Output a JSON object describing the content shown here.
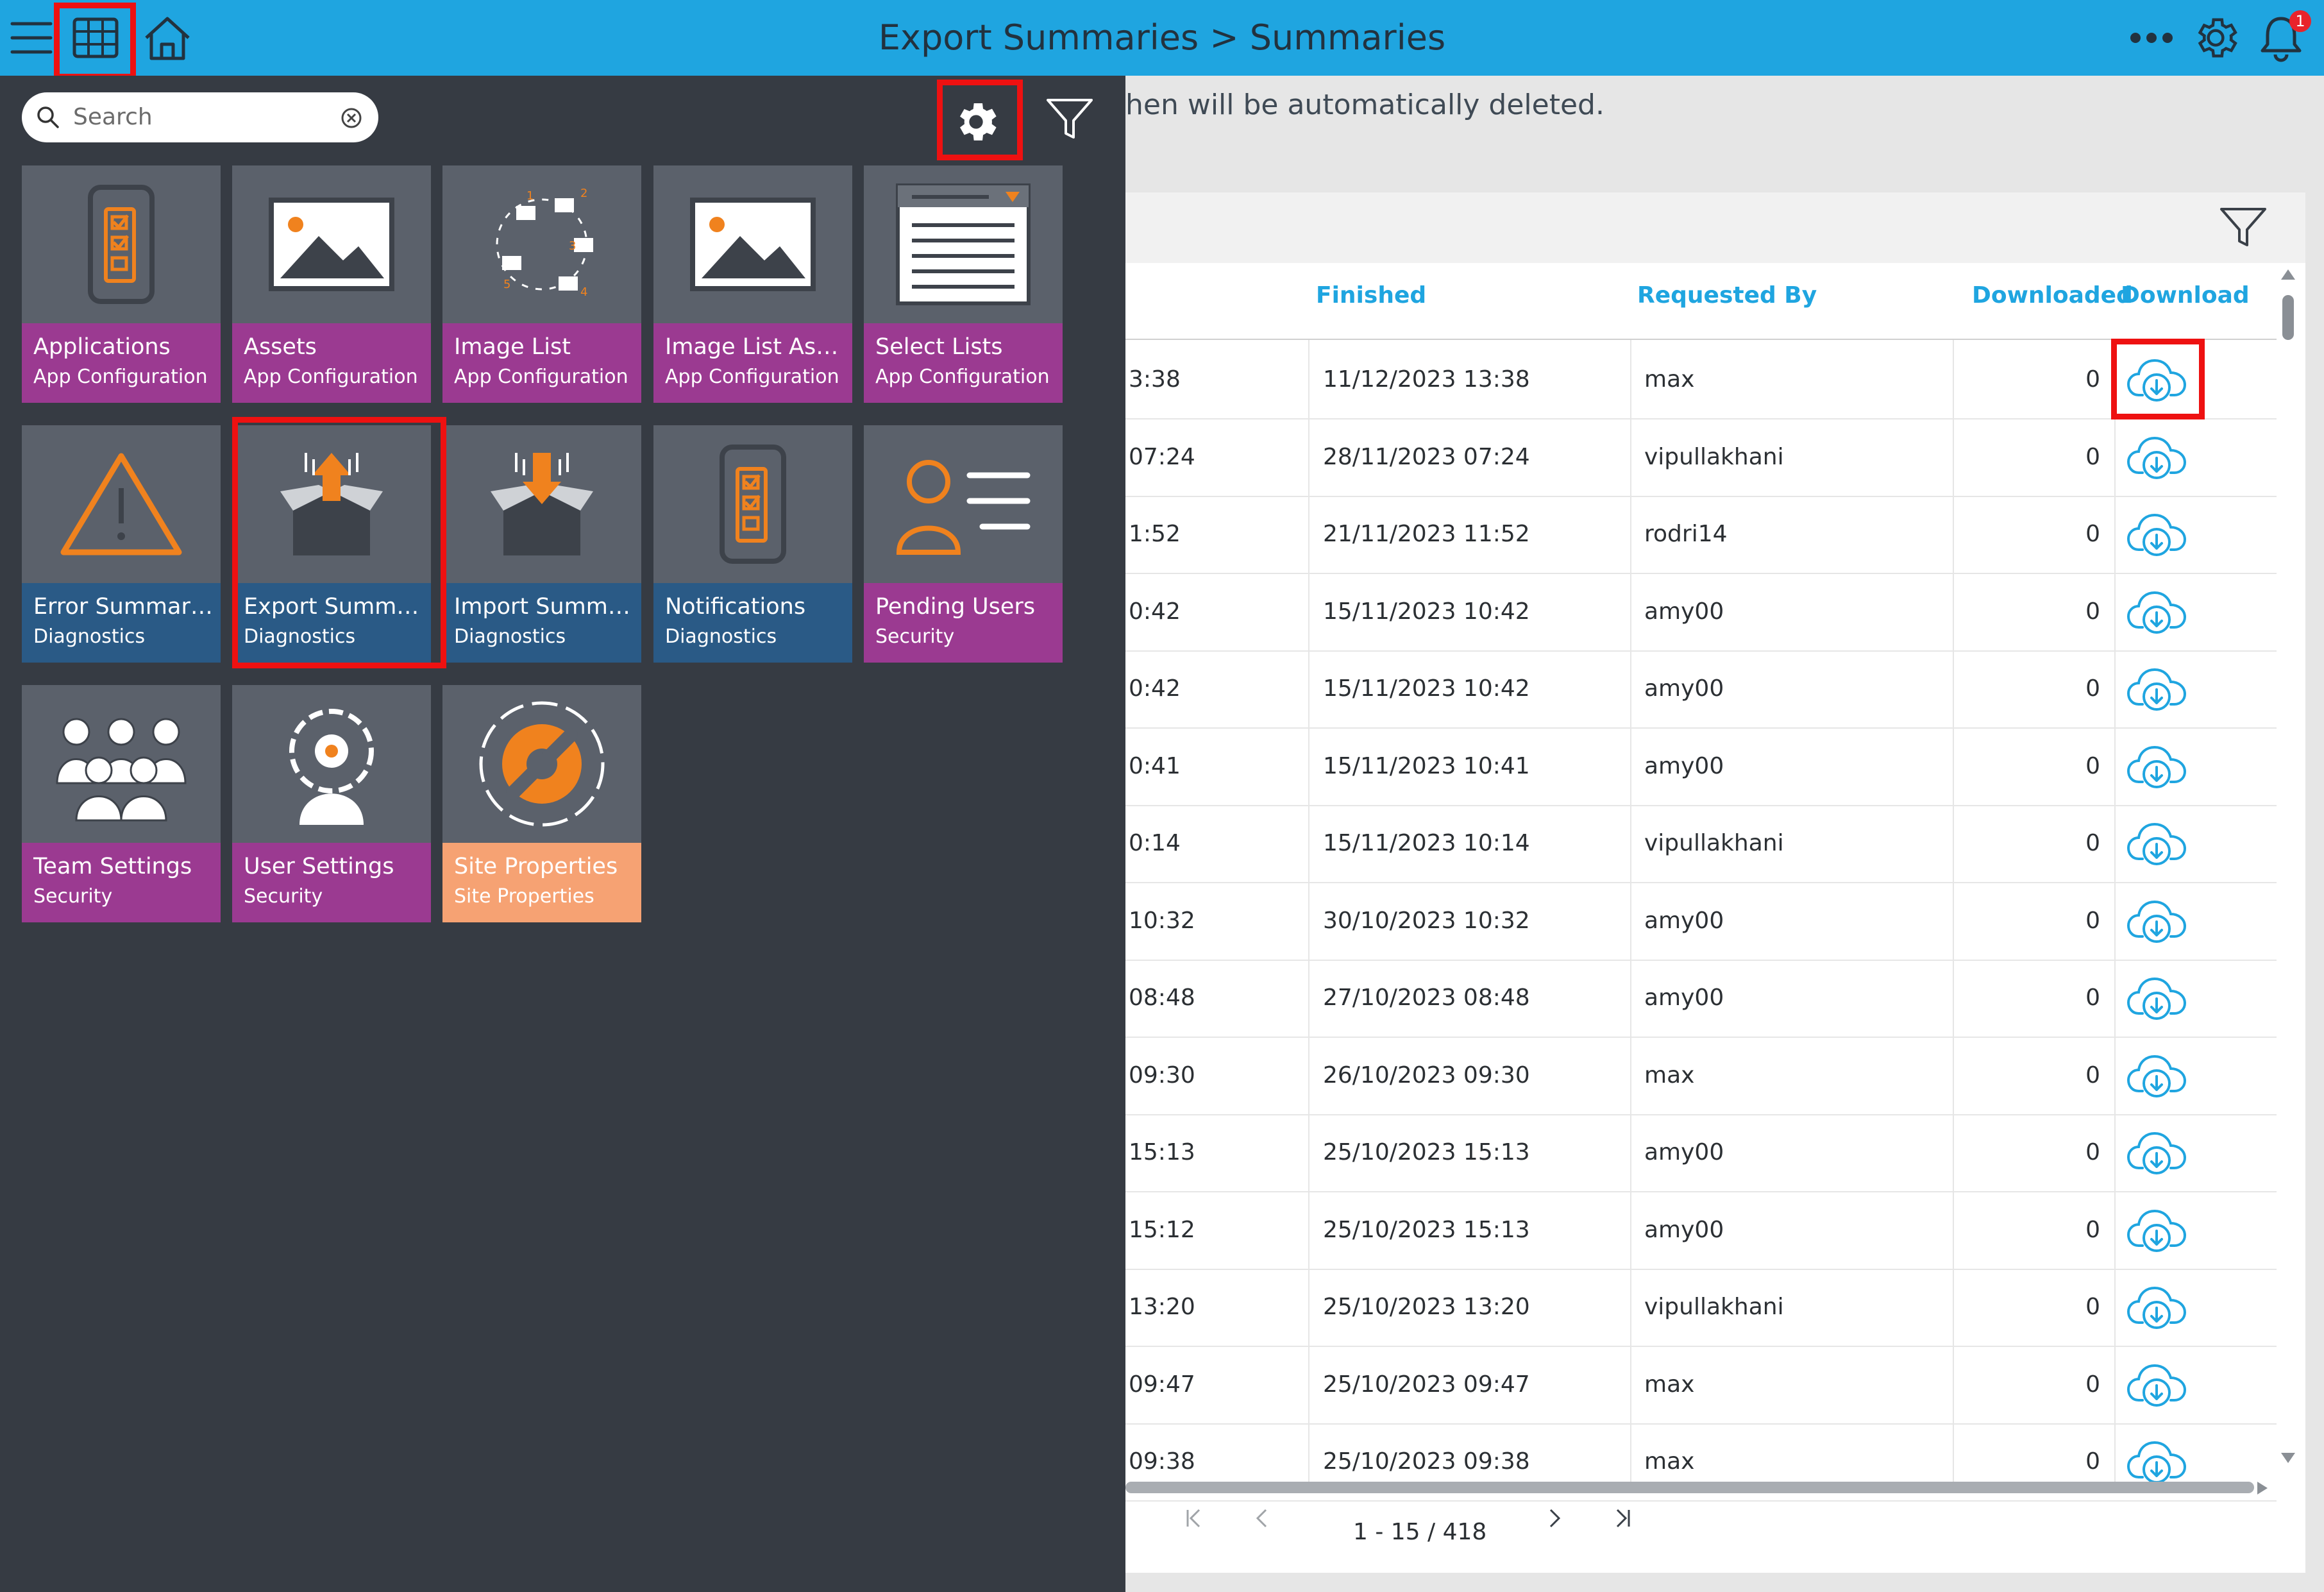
{
  "header": {
    "title": "Export Summaries > Summaries",
    "notification_count": "1"
  },
  "drawer": {
    "search": {
      "placeholder": "Search"
    },
    "tiles": [
      {
        "title": "Applications",
        "category": "App Configuration",
        "icon": "mobile-checklist-icon",
        "color": "purple"
      },
      {
        "title": "Assets",
        "category": "App Configuration",
        "icon": "image-icon",
        "color": "purple"
      },
      {
        "title": "Image List",
        "category": "App Configuration",
        "icon": "image-list-icon",
        "color": "purple"
      },
      {
        "title": "Image List Ass...",
        "category": "App Configuration",
        "icon": "image-icon",
        "color": "purple"
      },
      {
        "title": "Select Lists",
        "category": "App Configuration",
        "icon": "select-list-icon",
        "color": "purple"
      },
      {
        "title": "Error Summari...",
        "category": "Diagnostics",
        "icon": "warning-icon",
        "color": "blue"
      },
      {
        "title": "Export Summa...",
        "category": "Diagnostics",
        "icon": "export-box-icon",
        "color": "blue"
      },
      {
        "title": "Import Summa...",
        "category": "Diagnostics",
        "icon": "import-box-icon",
        "color": "blue"
      },
      {
        "title": "Notifications",
        "category": "Diagnostics",
        "icon": "mobile-checklist-icon",
        "color": "blue"
      },
      {
        "title": "Pending Users",
        "category": "Security",
        "icon": "pending-user-icon",
        "color": "purple"
      },
      {
        "title": "Team Settings",
        "category": "Security",
        "icon": "team-icon",
        "color": "purple"
      },
      {
        "title": "User Settings",
        "category": "Security",
        "icon": "user-gear-icon",
        "color": "purple"
      },
      {
        "title": "Site Properties",
        "category": "Site Properties",
        "icon": "wrench-gear-icon",
        "color": "peach"
      }
    ]
  },
  "main": {
    "notice": "hen will be automatically deleted.",
    "columns": {
      "finished": "Finished",
      "requested_by": "Requested By",
      "downloaded": "Downloaded",
      "download": "Download"
    },
    "rows": [
      {
        "started": "3:38",
        "finished": "11/12/2023 13:38",
        "requested_by": "max",
        "downloaded": "0"
      },
      {
        "started": "07:24",
        "finished": "28/11/2023 07:24",
        "requested_by": "vipullakhani",
        "downloaded": "0"
      },
      {
        "started": "1:52",
        "finished": "21/11/2023 11:52",
        "requested_by": "rodri14",
        "downloaded": "0"
      },
      {
        "started": "0:42",
        "finished": "15/11/2023 10:42",
        "requested_by": "amy00",
        "downloaded": "0"
      },
      {
        "started": "0:42",
        "finished": "15/11/2023 10:42",
        "requested_by": "amy00",
        "downloaded": "0"
      },
      {
        "started": "0:41",
        "finished": "15/11/2023 10:41",
        "requested_by": "amy00",
        "downloaded": "0"
      },
      {
        "started": "0:14",
        "finished": "15/11/2023 10:14",
        "requested_by": "vipullakhani",
        "downloaded": "0"
      },
      {
        "started": "10:32",
        "finished": "30/10/2023 10:32",
        "requested_by": "amy00",
        "downloaded": "0"
      },
      {
        "started": "08:48",
        "finished": "27/10/2023 08:48",
        "requested_by": "amy00",
        "downloaded": "0"
      },
      {
        "started": "09:30",
        "finished": "26/10/2023 09:30",
        "requested_by": "max",
        "downloaded": "0"
      },
      {
        "started": "15:13",
        "finished": "25/10/2023 15:13",
        "requested_by": "amy00",
        "downloaded": "0"
      },
      {
        "started": "15:12",
        "finished": "25/10/2023 15:13",
        "requested_by": "amy00",
        "downloaded": "0"
      },
      {
        "started": "13:20",
        "finished": "25/10/2023 13:20",
        "requested_by": "vipullakhani",
        "downloaded": "0"
      },
      {
        "started": "09:47",
        "finished": "25/10/2023 09:47",
        "requested_by": "max",
        "downloaded": "0"
      },
      {
        "started": "09:38",
        "finished": "25/10/2023 09:38",
        "requested_by": "max",
        "downloaded": "0"
      }
    ],
    "pager": {
      "range": "1 - 15 / 418"
    }
  },
  "colors": {
    "accent": "#1fa5e0",
    "highlight": "#ee1111",
    "drawer": "#363b43",
    "orange": "#f0821e"
  }
}
